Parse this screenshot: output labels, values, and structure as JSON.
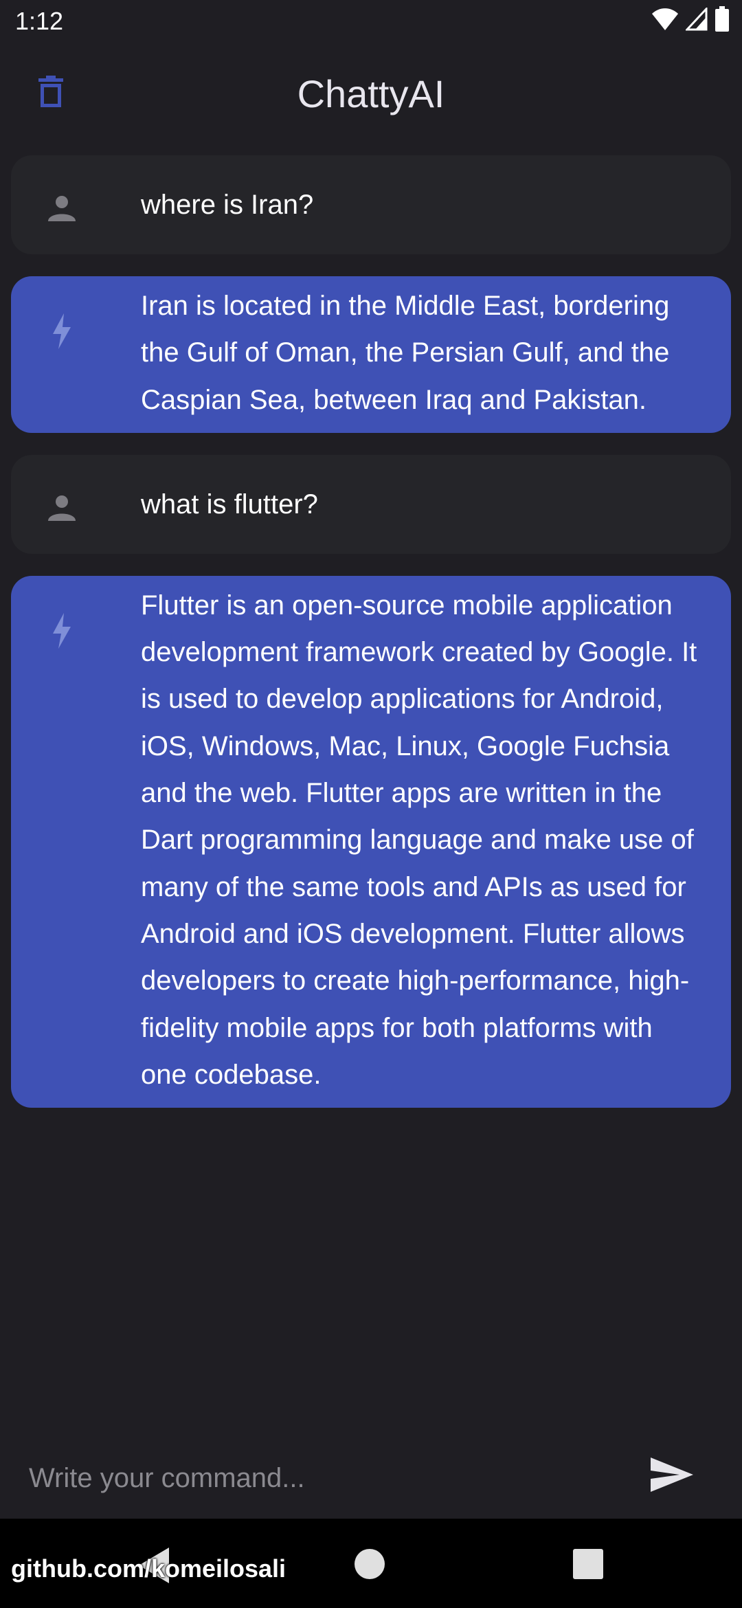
{
  "status_bar": {
    "time": "1:12",
    "icons": [
      "wifi-icon",
      "cellular-signal-icon",
      "battery-icon"
    ]
  },
  "app_bar": {
    "title": "ChattyAI",
    "delete_icon": "trash-icon"
  },
  "messages": [
    {
      "role": "user",
      "icon": "person-icon",
      "text": "where is Iran?"
    },
    {
      "role": "bot",
      "icon": "bolt-icon",
      "text": "Iran is located in the Middle East, bordering the Gulf of Oman, the Persian Gulf, and the Caspian Sea, between Iraq and Pakistan."
    },
    {
      "role": "user",
      "icon": "person-icon",
      "text": "what is flutter?"
    },
    {
      "role": "bot",
      "icon": "bolt-icon",
      "text": "Flutter is an open-source mobile application development framework created by Google. It is used to develop applications for Android, iOS, Windows, Mac, Linux, Google Fuchsia and the web. Flutter apps are written in the Dart programming language and make use of many of the same tools and APIs as used for Android and iOS development. Flutter allows developers to create high-performance, high-fidelity mobile apps for both platforms with one codebase."
    }
  ],
  "input": {
    "placeholder": "Write your command...",
    "value": "",
    "send_icon": "send-icon"
  },
  "nav_bar": {
    "icons": [
      "back-icon",
      "home-icon",
      "recents-icon"
    ]
  },
  "watermark": "github.com/komeilosali",
  "colors": {
    "background": "#1f1e23",
    "user_bubble": "#252529",
    "bot_bubble": "#3f51b5",
    "accent": "#3f51b5"
  }
}
